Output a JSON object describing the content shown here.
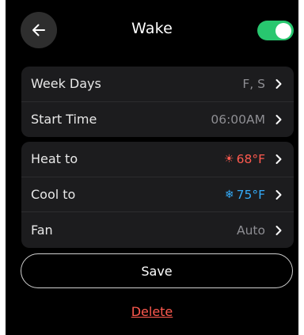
{
  "header": {
    "back_icon": "arrow-left-icon",
    "title": "Wake",
    "enabled": true,
    "toggle_color": "#28c76f"
  },
  "schedule": {
    "rows": [
      {
        "label": "Week Days",
        "value": "F, S"
      },
      {
        "label": "Start Time",
        "value": "06:00AM"
      }
    ]
  },
  "climate": {
    "rows": [
      {
        "label": "Heat to",
        "value": "68°F",
        "icon": "sun-icon",
        "icon_glyph": "☀",
        "color": "#ff5a4f"
      },
      {
        "label": "Cool to",
        "value": "75°F",
        "icon": "snowflake-icon",
        "icon_glyph": "❄",
        "color": "#34aaf7"
      },
      {
        "label": "Fan",
        "value": "Auto"
      }
    ]
  },
  "actions": {
    "save_label": "Save",
    "delete_label": "Delete"
  }
}
